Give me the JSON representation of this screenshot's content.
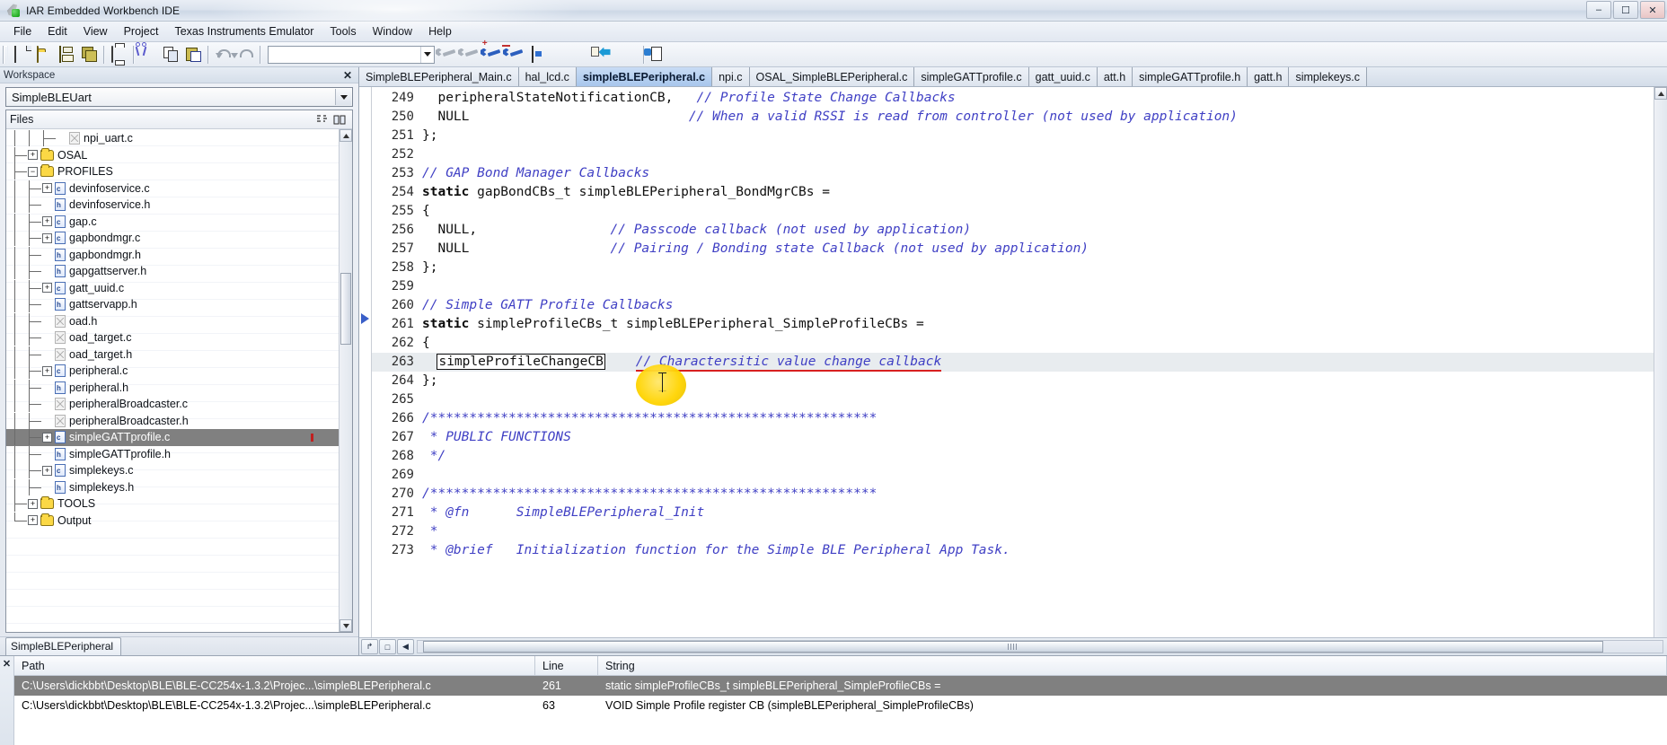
{
  "window": {
    "title": "IAR Embedded Workbench IDE",
    "app_icon": "iar-logo-icon",
    "minimize": "–",
    "maximize": "☐",
    "close": "✕"
  },
  "menu": {
    "items": [
      {
        "label": "File"
      },
      {
        "label": "Edit"
      },
      {
        "label": "View"
      },
      {
        "label": "Project"
      },
      {
        "label": "Texas Instruments Emulator"
      },
      {
        "label": "Tools"
      },
      {
        "label": "Window"
      },
      {
        "label": "Help"
      }
    ]
  },
  "toolbar": {
    "buttons": [
      {
        "name": "new-document-icon",
        "title": "New Document"
      },
      {
        "name": "open-folder-icon",
        "title": "Open"
      },
      {
        "name": "save-icon",
        "title": "Save"
      },
      {
        "name": "save-all-icon",
        "title": "Save All"
      },
      {
        "name": "print-icon",
        "title": "Print"
      },
      {
        "name": "cut-icon",
        "title": "Cut"
      },
      {
        "name": "copy-icon",
        "title": "Copy"
      },
      {
        "name": "paste-icon",
        "title": "Paste"
      },
      {
        "name": "undo-icon",
        "title": "Undo"
      },
      {
        "name": "redo-icon",
        "title": "Redo"
      },
      {
        "name": "quick-search-combo",
        "title": "Quick Search"
      },
      {
        "name": "wrench-grey-icon",
        "title": "Toggle Breakpoint"
      },
      {
        "name": "wrench-grey2-icon",
        "title": "Toggle Breakpoint 2"
      },
      {
        "name": "wrench-blue-add-icon",
        "title": "Add Breakpoint"
      },
      {
        "name": "wrench-blue-remove-icon",
        "title": "Remove Breakpoint"
      },
      {
        "name": "debug-window-icon",
        "title": "Debug Window"
      },
      {
        "name": "arrow-green-icon",
        "title": "Go"
      },
      {
        "name": "arrow-cyan-icon",
        "title": "Step Over"
      },
      {
        "name": "arrow-back-doc-icon",
        "title": "Step Into"
      },
      {
        "name": "arrow-grey-icon",
        "title": "Step Out"
      },
      {
        "name": "doc-debug-icon",
        "title": "Next Statement"
      }
    ],
    "search_value": ""
  },
  "workspace": {
    "panel_title": "Workspace",
    "close_label": "✕",
    "selected_project": "SimpleBLEUart",
    "files_header": "Files",
    "header_icons": [
      "sort-toggle-icon",
      "column-toggle-icon"
    ],
    "active_tab": "SimpleBLEPeripheral",
    "tree": [
      {
        "label": "npi_uart.c",
        "depth": 3,
        "type": "file-x",
        "expand": "none",
        "selected": false
      },
      {
        "label": "OSAL",
        "depth": 1,
        "type": "folder",
        "expand": "plus",
        "selected": false
      },
      {
        "label": "PROFILES",
        "depth": 1,
        "type": "folder",
        "expand": "minus",
        "selected": false
      },
      {
        "label": "devinfoservice.c",
        "depth": 2,
        "type": "file-c",
        "expand": "plus",
        "selected": false
      },
      {
        "label": "devinfoservice.h",
        "depth": 2,
        "type": "file-h",
        "expand": "none",
        "selected": false
      },
      {
        "label": "gap.c",
        "depth": 2,
        "type": "file-c",
        "expand": "plus",
        "selected": false
      },
      {
        "label": "gapbondmgr.c",
        "depth": 2,
        "type": "file-c",
        "expand": "plus",
        "selected": false
      },
      {
        "label": "gapbondmgr.h",
        "depth": 2,
        "type": "file-h",
        "expand": "none",
        "selected": false
      },
      {
        "label": "gapgattserver.h",
        "depth": 2,
        "type": "file-h",
        "expand": "none",
        "selected": false
      },
      {
        "label": "gatt_uuid.c",
        "depth": 2,
        "type": "file-c",
        "expand": "plus",
        "selected": false
      },
      {
        "label": "gattservapp.h",
        "depth": 2,
        "type": "file-h",
        "expand": "none",
        "selected": false
      },
      {
        "label": "oad.h",
        "depth": 2,
        "type": "file-x",
        "expand": "none",
        "selected": false
      },
      {
        "label": "oad_target.c",
        "depth": 2,
        "type": "file-x",
        "expand": "none",
        "selected": false
      },
      {
        "label": "oad_target.h",
        "depth": 2,
        "type": "file-x",
        "expand": "none",
        "selected": false
      },
      {
        "label": "peripheral.c",
        "depth": 2,
        "type": "file-c",
        "expand": "plus",
        "selected": false
      },
      {
        "label": "peripheral.h",
        "depth": 2,
        "type": "file-h",
        "expand": "none",
        "selected": false
      },
      {
        "label": "peripheralBroadcaster.c",
        "depth": 2,
        "type": "file-x",
        "expand": "none",
        "selected": false
      },
      {
        "label": "peripheralBroadcaster.h",
        "depth": 2,
        "type": "file-x",
        "expand": "none",
        "selected": false
      },
      {
        "label": "simpleGATTprofile.c",
        "depth": 2,
        "type": "file-c",
        "expand": "plus",
        "selected": true
      },
      {
        "label": "simpleGATTprofile.h",
        "depth": 2,
        "type": "file-h",
        "expand": "none",
        "selected": false
      },
      {
        "label": "simplekeys.c",
        "depth": 2,
        "type": "file-c",
        "expand": "plus",
        "selected": false
      },
      {
        "label": "simplekeys.h",
        "depth": 2,
        "type": "file-h",
        "expand": "none",
        "selected": false
      },
      {
        "label": "TOOLS",
        "depth": 1,
        "type": "folder",
        "expand": "plus",
        "selected": false
      },
      {
        "label": "Output",
        "depth": 1,
        "type": "folder",
        "expand": "plus",
        "selected": false
      }
    ]
  },
  "editor": {
    "tabs": [
      {
        "label": "SimpleBLEPeripheral_Main.c",
        "active": false
      },
      {
        "label": "hal_lcd.c",
        "active": false
      },
      {
        "label": "simpleBLEPeripheral.c",
        "active": true
      },
      {
        "label": "npi.c",
        "active": false
      },
      {
        "label": "OSAL_SimpleBLEPeripheral.c",
        "active": false
      },
      {
        "label": "simpleGATTprofile.c",
        "active": false
      },
      {
        "label": "gatt_uuid.c",
        "active": false
      },
      {
        "label": "att.h",
        "active": false
      },
      {
        "label": "simpleGATTprofile.h",
        "active": false
      },
      {
        "label": "gatt.h",
        "active": false
      },
      {
        "label": "simplekeys.c",
        "active": false
      }
    ],
    "lines": [
      {
        "num": "249",
        "segments": [
          {
            "t": "  peripheralStateNotificationCB,   ",
            "s": "pln"
          },
          {
            "t": "// Profile State Change Callbacks",
            "s": "cm"
          }
        ]
      },
      {
        "num": "250",
        "segments": [
          {
            "t": "  NULL                            ",
            "s": "pln"
          },
          {
            "t": "// When a valid RSSI is read from controller (not used by application)",
            "s": "cm"
          }
        ]
      },
      {
        "num": "251",
        "segments": [
          {
            "t": "};",
            "s": "pln"
          }
        ]
      },
      {
        "num": "252",
        "segments": [
          {
            "t": "",
            "s": "pln"
          }
        ]
      },
      {
        "num": "253",
        "segments": [
          {
            "t": "// GAP Bond Manager Callbacks",
            "s": "cm"
          }
        ]
      },
      {
        "num": "254",
        "segments": [
          {
            "t": "static",
            "s": "kw"
          },
          {
            "t": " gapBondCBs_t simpleBLEPeripheral_BondMgrCBs =",
            "s": "pln"
          }
        ]
      },
      {
        "num": "255",
        "segments": [
          {
            "t": "{",
            "s": "pln"
          }
        ]
      },
      {
        "num": "256",
        "segments": [
          {
            "t": "  NULL,                 ",
            "s": "pln"
          },
          {
            "t": "// Passcode callback (not used by application)",
            "s": "cm"
          }
        ]
      },
      {
        "num": "257",
        "segments": [
          {
            "t": "  NULL                  ",
            "s": "pln"
          },
          {
            "t": "// Pairing / Bonding state Callback (not used by application)",
            "s": "cm"
          }
        ]
      },
      {
        "num": "258",
        "segments": [
          {
            "t": "};",
            "s": "pln"
          }
        ]
      },
      {
        "num": "259",
        "segments": [
          {
            "t": "",
            "s": "pln"
          }
        ]
      },
      {
        "num": "260",
        "segments": [
          {
            "t": "// Simple GATT Profile Callbacks",
            "s": "cm"
          }
        ]
      },
      {
        "num": "261",
        "segments": [
          {
            "t": "static",
            "s": "kw"
          },
          {
            "t": " simpleProfileCBs_t simpleBLEPeripheral_SimpleProfileCBs =",
            "s": "pln"
          }
        ]
      },
      {
        "num": "262",
        "segments": [
          {
            "t": "{",
            "s": "pln"
          }
        ]
      },
      {
        "num": "263",
        "highlight": true,
        "segments": [
          {
            "t": "  ",
            "s": "pln"
          },
          {
            "t": "simpleProfileChangeCB",
            "s": "selbox"
          },
          {
            "t": "    ",
            "s": "pln"
          },
          {
            "t": "// Charactersitic value change callback",
            "s": "cm-underline"
          }
        ]
      },
      {
        "num": "264",
        "segments": [
          {
            "t": "};",
            "s": "pln"
          }
        ]
      },
      {
        "num": "265",
        "segments": [
          {
            "t": "",
            "s": "pln"
          }
        ]
      },
      {
        "num": "266",
        "segments": [
          {
            "t": "/*********************************************************",
            "s": "cm"
          }
        ]
      },
      {
        "num": "267",
        "segments": [
          {
            "t": " * PUBLIC FUNCTIONS",
            "s": "cm"
          }
        ]
      },
      {
        "num": "268",
        "segments": [
          {
            "t": " */",
            "s": "cm"
          }
        ]
      },
      {
        "num": "269",
        "segments": [
          {
            "t": "",
            "s": "pln"
          }
        ]
      },
      {
        "num": "270",
        "segments": [
          {
            "t": "/*********************************************************",
            "s": "cm"
          }
        ]
      },
      {
        "num": "271",
        "segments": [
          {
            "t": " * @fn      SimpleBLEPeripheral_Init",
            "s": "cm"
          }
        ]
      },
      {
        "num": "272",
        "segments": [
          {
            "t": " *",
            "s": "cm"
          }
        ]
      },
      {
        "num": "273",
        "segments": [
          {
            "t": " * @brief   Initialization function for the Simple BLE Peripheral App Task.",
            "s": "cm"
          }
        ]
      }
    ],
    "bottom_buttons": [
      {
        "name": "go-to-line-button",
        "glyph": "↱"
      },
      {
        "name": "toggle-split-button",
        "glyph": "□"
      },
      {
        "name": "scroll-left-button",
        "glyph": "◀"
      }
    ],
    "hscroll_grip": "‖"
  },
  "results": {
    "close_label": "✕",
    "columns": [
      "Path",
      "Line",
      "String"
    ],
    "rows": [
      {
        "path": "C:\\Users\\dickbbt\\Desktop\\BLE\\BLE-CC254x-1.3.2\\Projec...\\simpleBLEPeripheral.c",
        "line": "261",
        "string": "static simpleProfileCBs_t simpleBLEPeripheral_SimpleProfileCBs =",
        "selected": true
      },
      {
        "path": "C:\\Users\\dickbbt\\Desktop\\BLE\\BLE-CC254x-1.3.2\\Projec...\\simpleBLEPeripheral.c",
        "line": "63",
        "string": "VOID Simple Profile register CB (simpleBLEPeripheral_SimpleProfileCBs)",
        "selected": false
      }
    ]
  },
  "colors": {
    "comment": "#3f3fc4",
    "selection": "#808080",
    "active_tab": "#a8c6ec",
    "highlight_marker": "#ffd400",
    "underline": "#d82020"
  }
}
